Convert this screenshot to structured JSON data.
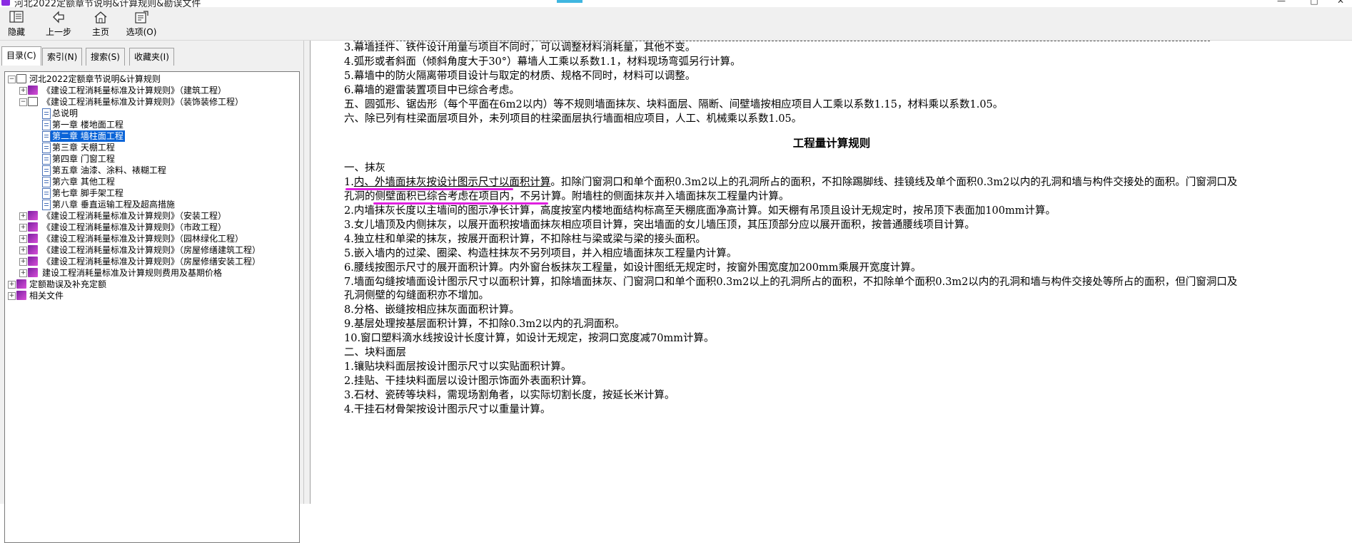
{
  "window": {
    "title": "河北2022定额章节说明&计算规则&勘误文件",
    "controls": [
      "—",
      "□",
      "✕"
    ]
  },
  "toolbar": {
    "buttons": [
      {
        "label": "隐藏",
        "icon": "hide-icon"
      },
      {
        "label": "上一步",
        "icon": "back-arrow-icon"
      },
      {
        "label": "主页",
        "icon": "home-icon"
      },
      {
        "label": "选项(O)",
        "icon": "options-icon"
      }
    ]
  },
  "tabs": [
    "目录(C)",
    "索引(N)",
    "搜索(S)",
    "收藏夹(I)"
  ],
  "tree": [
    {
      "label": "河北2022定额章节说明&计算规则",
      "level": 0,
      "icon": "book-open",
      "exp": "−"
    },
    {
      "label": "《建设工程消耗量标准及计算规则》（建筑工程）",
      "level": 1,
      "icon": "book",
      "exp": "+"
    },
    {
      "label": "《建设工程消耗量标准及计算规则》（装饰装修工程）",
      "level": 1,
      "icon": "book-open",
      "exp": "−"
    },
    {
      "label": "总说明",
      "level": 2,
      "icon": "page",
      "exp": ""
    },
    {
      "label": "第一章 楼地面工程",
      "level": 2,
      "icon": "page",
      "exp": ""
    },
    {
      "label": "第二章 墙柱面工程",
      "level": 2,
      "icon": "page",
      "exp": "",
      "selected": true
    },
    {
      "label": "第三章 天棚工程",
      "level": 2,
      "icon": "page",
      "exp": ""
    },
    {
      "label": "第四章 门窗工程",
      "level": 2,
      "icon": "page",
      "exp": ""
    },
    {
      "label": "第五章 油漆、涂料、裱糊工程",
      "level": 2,
      "icon": "page",
      "exp": ""
    },
    {
      "label": "第六章 其他工程",
      "level": 2,
      "icon": "page",
      "exp": ""
    },
    {
      "label": "第七章 脚手架工程",
      "level": 2,
      "icon": "page",
      "exp": ""
    },
    {
      "label": "第八章 垂直运输工程及超高措施",
      "level": 2,
      "icon": "page",
      "exp": ""
    },
    {
      "label": "《建设工程消耗量标准及计算规则》（安装工程）",
      "level": 1,
      "icon": "book",
      "exp": "+"
    },
    {
      "label": "《建设工程消耗量标准及计算规则》（市政工程）",
      "level": 1,
      "icon": "book",
      "exp": "+"
    },
    {
      "label": "《建设工程消耗量标准及计算规则》（园林绿化工程）",
      "level": 1,
      "icon": "book",
      "exp": "+"
    },
    {
      "label": "《建设工程消耗量标准及计算规则》（房屋修缮建筑工程）",
      "level": 1,
      "icon": "book",
      "exp": "+"
    },
    {
      "label": "《建设工程消耗量标准及计算规则》（房屋修缮安装工程）",
      "level": 1,
      "icon": "book",
      "exp": "+"
    },
    {
      "label": "建设工程消耗量标准及计算规则费用及基期价格",
      "level": 1,
      "icon": "book",
      "exp": "+"
    },
    {
      "label": "定额勘误及补充定额",
      "level": 0,
      "icon": "book",
      "exp": "+"
    },
    {
      "label": "相关文件",
      "level": 0,
      "icon": "book",
      "exp": "+"
    }
  ],
  "content": {
    "lines_top": [
      "3.幕墙挂件、铁件设计用量与项目不同时，可以调整材料消耗量，其他不变。",
      "4.弧形或者斜面（倾斜角度大于30°）幕墙人工乘以系数1.1，材料现场弯弧另行计算。",
      "5.幕墙中的防火隔离带项目设计与取定的材质、规格不同时，材料可以调整。",
      "6.幕墙的避雷装置项目中已综合考虑。",
      "五、圆弧形、锯齿形（每个平面在6m2以内）等不规则墙面抹灰、块料面层、隔断、间壁墙按相应项目人工乘以系数1.15，材料乘以系数1.05。",
      "六、除已列有柱梁面层项目外，未列项目的柱梁面层执行墙面相应项目，人工、机械乘以系数1.05。"
    ],
    "heading": "工程量计算规则",
    "section1_title": "一、抹灰",
    "item1a_ul": "内、外墙面抹灰按设计图示尺寸以面积计算",
    "item1a_rest": "。扣除门窗洞口和单个面积0.3m2以上的孔洞所占的面积，不扣除踢脚线、挂镜线及单个面积0.3m2以内的孔洞和墙与构件交接处的面积。门窗洞口及",
    "item1b_pre": "孔洞的",
    "item1b_ul": "侧壁面积已综合考虑在项目内，不另计算",
    "item1b_rest": "。附墙柱的侧面抹灰并入墙面抹灰工程量内计算。",
    "lines_mid": [
      "2.内墙抹灰长度以主墙间的图示净长计算，高度按室内楼地面结构标高至天棚底面净高计算。如天棚有吊顶且设计无规定时，按吊顶下表面加100mm计算。",
      "3.女儿墙顶及内侧抹灰，以展开面积按墙面抹灰相应项目计算，突出墙面的女儿墙压顶，其压顶部分应以展开面积，按普通腰线项目计算。",
      "4.独立柱和单梁的抹灰，按展开面积计算，不扣除柱与梁或梁与梁的接头面积。",
      "5.嵌入墙内的过梁、圈梁、构造柱抹灰不另列项目，并入相应墙面抹灰工程量内计算。",
      "6.腰线按图示尺寸的展开面积计算。内外窗台板抹灰工程量，如设计图纸无规定时，按窗外围宽度加200mm乘展开宽度计算。",
      "7.墙面勾缝按墙面设计图示尺寸以面积计算，扣除墙面抹灰、门窗洞口和单个面积0.3m2以上的孔洞所占的面积，不扣除单个面积0.3m2以内的孔洞和墙与构件交接处等所占的面积，但门窗洞口及",
      "孔洞侧壁的勾缝面积亦不增加。",
      "8.分格、嵌缝按相应抹灰面面积计算。",
      "9.基层处理按基层面积计算，不扣除0.3m2以内的孔洞面积。",
      "10.窗口塑料滴水线按设计长度计算，如设计无规定，按洞口宽度减70mm计算。",
      "二、块料面层",
      "1.镶贴块料面层按设计图示尺寸以实贴面积计算。",
      "2.挂贴、干挂块料面层以设计图示饰面外表面积计算。",
      "3.石材、瓷砖等块料，需现场割角者，以实际切割长度，按延长米计算。",
      "4.干挂石材骨架按设计图示尺寸以重量计算。"
    ]
  },
  "colors": {
    "highlight": "#e020e0",
    "selection": "#0a64d8"
  }
}
